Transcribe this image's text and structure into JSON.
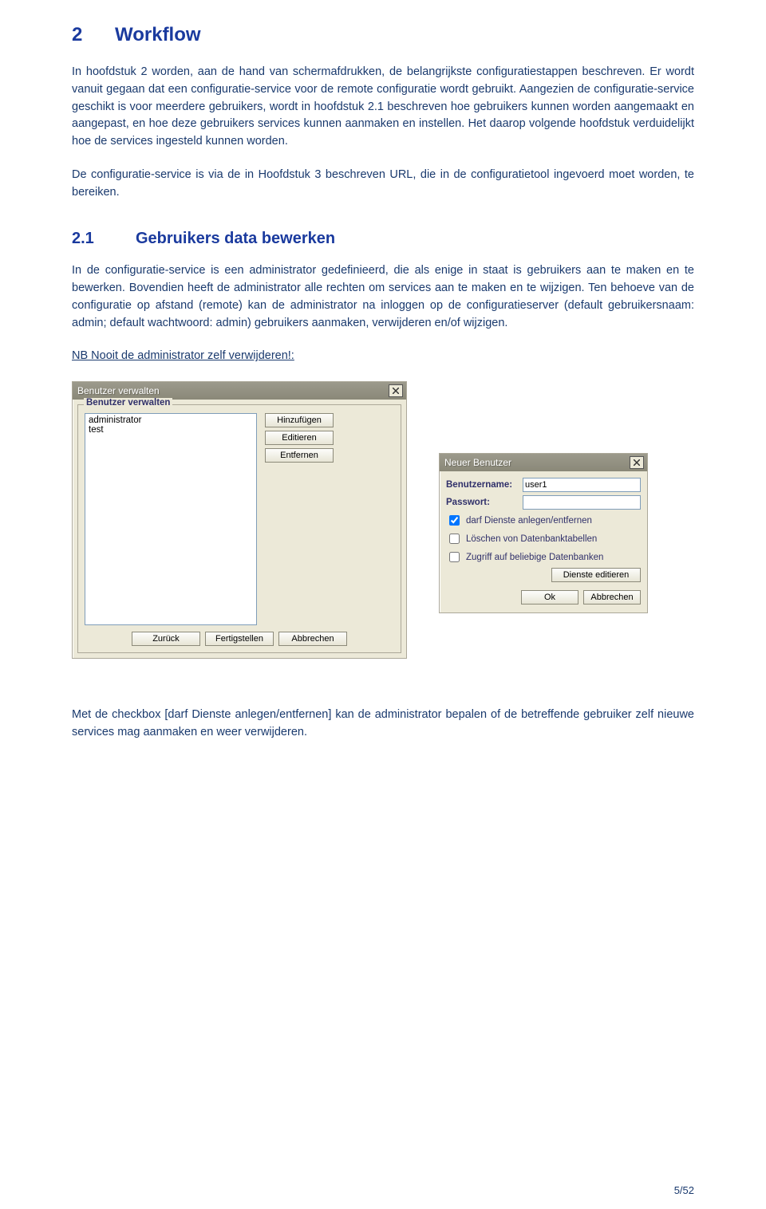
{
  "headings": {
    "h1_num": "2",
    "h1_text": "Workflow",
    "h2_num": "2.1",
    "h2_text": "Gebruikers data bewerken"
  },
  "paragraphs": {
    "p1": "In hoofdstuk 2 worden, aan de hand van schermafdrukken, de belangrijkste configuratiestappen beschreven. Er wordt vanuit gegaan dat een configuratie-service voor de remote configuratie wordt gebruikt. Aangezien de configuratie-service geschikt is voor meerdere gebruikers, wordt in hoofdstuk 2.1 beschreven hoe gebruikers kunnen worden aangemaakt en aangepast, en hoe deze gebruikers services kunnen aanmaken en instellen. Het daarop volgende hoofdstuk verduidelijkt hoe de services ingesteld kunnen worden.",
    "p2": "De configuratie-service is via de in Hoofdstuk 3  beschreven URL, die in de configuratietool ingevoerd moet worden, te bereiken.",
    "p3": "In de configuratie-service is een administrator gedefinieerd, die als enige in staat is gebruikers aan te maken en te bewerken. Bovendien heeft de administrator alle rechten om services aan te maken en te wijzigen. Ten behoeve van de configuratie op afstand (remote) kan de administrator na inloggen op de configuratieserver (default gebruikersnaam: admin; default wachtwoord: admin) gebruikers aanmaken, verwijderen en/of wijzigen.",
    "nb": "NB Nooit de administrator zelf verwijderen!:",
    "p4": "Met de checkbox [darf Dienste anlegen/entfernen] kan de administrator bepalen of de betreffende gebruiker zelf nieuwe services mag aanmaken en weer verwijderen."
  },
  "dialog1": {
    "title": "Benutzer verwalten",
    "group_legend": "Benutzer verwalten",
    "list_items": [
      "administrator",
      "test"
    ],
    "buttons": {
      "add": "Hinzufügen",
      "edit": "Editieren",
      "remove": "Entfernen",
      "back": "Zurück",
      "finish": "Fertigstellen",
      "cancel": "Abbrechen"
    }
  },
  "dialog2": {
    "title": "Neuer Benutzer",
    "labels": {
      "username": "Benutzername:",
      "password": "Passwort:"
    },
    "username_value": "user1",
    "checkboxes": {
      "services": "darf Dienste anlegen/entfernen",
      "delete_tables": "Löschen von Datenbanktabellen",
      "any_db": "Zugriff auf beliebige Datenbanken"
    },
    "buttons": {
      "edit_services": "Dienste editieren",
      "ok": "Ok",
      "cancel": "Abbrechen"
    }
  },
  "page_number": "5/52"
}
